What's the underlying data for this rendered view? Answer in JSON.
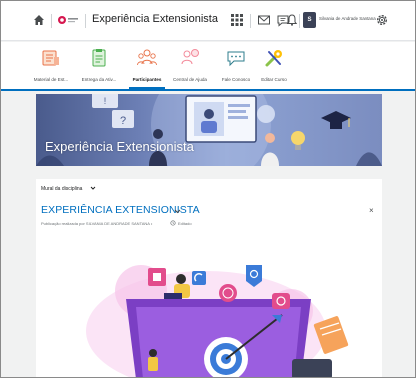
{
  "topbar": {
    "course_title": "Experiência Extensionista",
    "user_initial": "S",
    "user_name": "Silvania de Andrade Santana"
  },
  "navbar": {
    "items": [
      {
        "label": "Material de Est..."
      },
      {
        "label": "Entrega da Ativ..."
      },
      {
        "label": "Participantes",
        "active": true
      },
      {
        "label": "Central de Ajuda"
      },
      {
        "label": "Fale Conosco"
      },
      {
        "label": "Editar Curso"
      }
    ]
  },
  "banner": {
    "title": "Experiência Extensionista"
  },
  "feed": {
    "section_label": "Mural da disciplina",
    "post_title": "EXPERIÊNCIA EXTENSIONISTA",
    "post_meta": "Publicação realizada por SILVANIA DE ANDRADE SANTANA •",
    "post_edited": "Editado",
    "close_symbol": "×"
  },
  "colors": {
    "accent": "#006fbf",
    "illustration_purple": "#7b3fc4",
    "illustration_pink": "#f2a7e0"
  }
}
